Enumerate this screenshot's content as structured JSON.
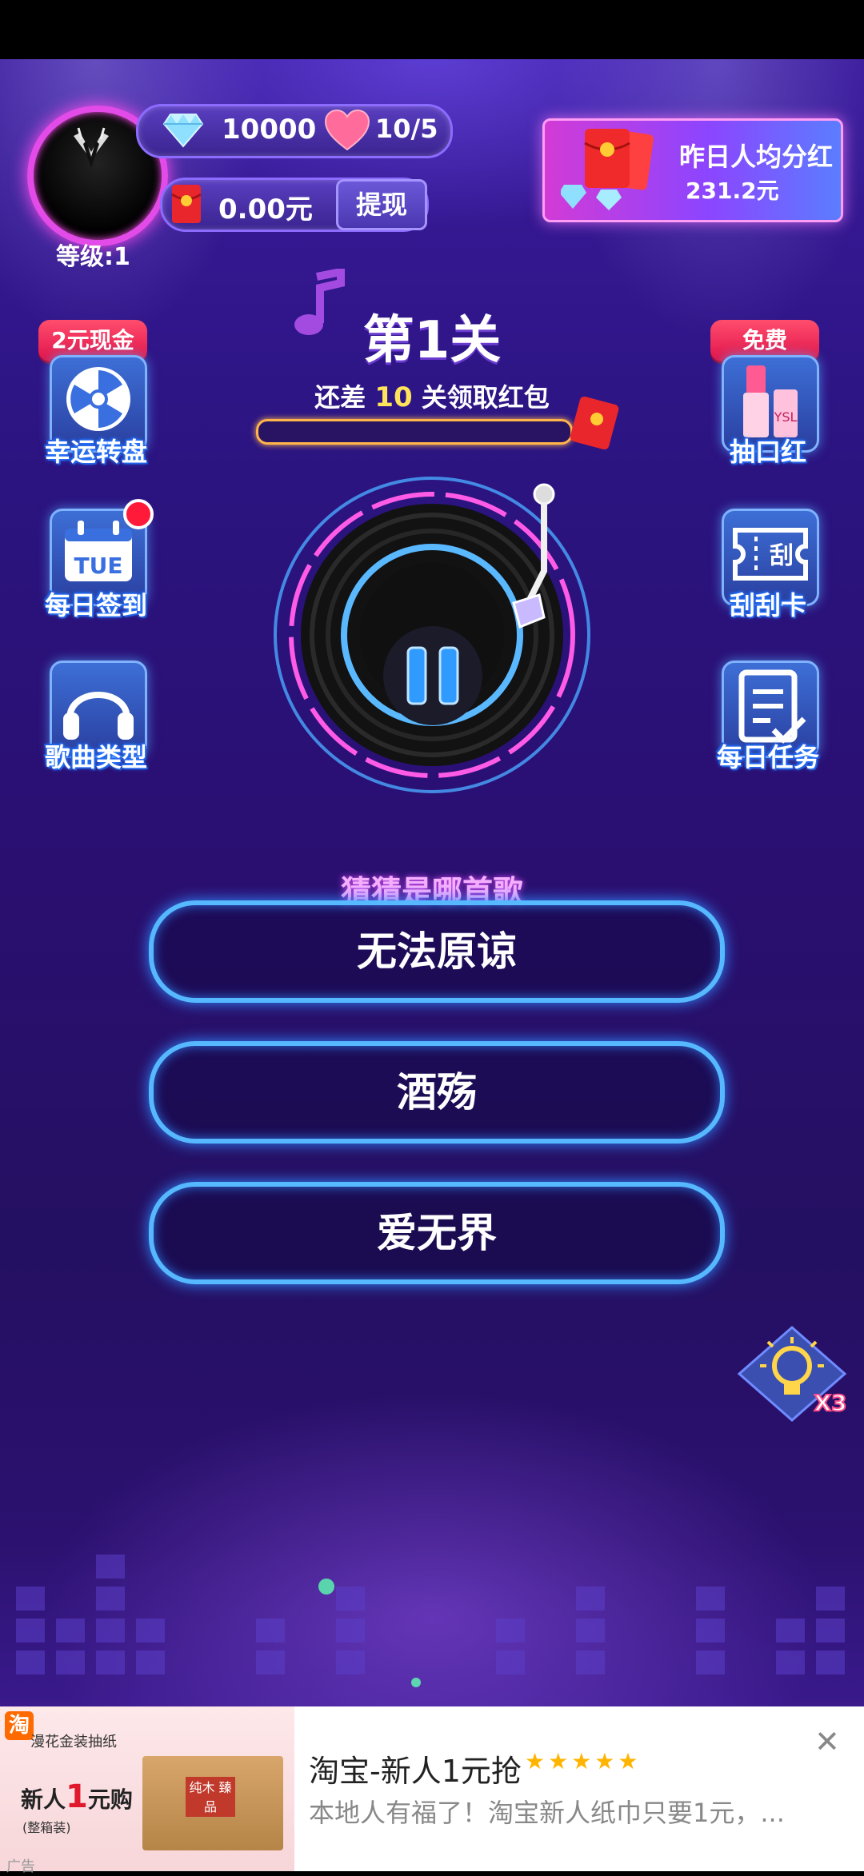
{
  "header": {
    "diamonds": "10000",
    "hearts": "10/5",
    "money": "0.00元",
    "withdraw_label": "提现",
    "level": "等级:1"
  },
  "bonus": {
    "title": "昨日人均分红",
    "value": "231.2元"
  },
  "left_buttons": [
    {
      "label": "幸运转盘",
      "ribbon": "2元现金",
      "icon": "wheel-icon"
    },
    {
      "label": "每日签到",
      "icon": "calendar-icon",
      "calendar_text": "TUE"
    },
    {
      "label": "歌曲类型",
      "icon": "headphones-icon"
    }
  ],
  "right_buttons": [
    {
      "label": "抽口红",
      "ribbon": "免费",
      "icon": "lipstick-icon"
    },
    {
      "label": "刮刮卡",
      "icon": "ticket-icon",
      "ticket_text": "刮"
    },
    {
      "label": "每日任务",
      "icon": "task-icon"
    }
  ],
  "game": {
    "level_title": "第1关",
    "hint_prefix": "还差",
    "hint_num": "10",
    "hint_suffix": "关领取红包",
    "progress": 0.0,
    "question": "猜猜是哪首歌",
    "answers": [
      "无法原谅",
      "酒殇",
      "爱无界"
    ],
    "hint_multiplier": "X3"
  },
  "ad": {
    "title": "淘宝-新人1元抢",
    "stars": "★★★★★",
    "description": "本地人有福了！淘宝新人纸巾只要1元，...",
    "close": "✕",
    "label": "广告",
    "image_logo": "淘",
    "image_title": "漫花金装抽纸",
    "image_big_prefix": "新人",
    "image_big_num": "1",
    "image_big_suffix": "元购",
    "image_sub": "(整箱装)",
    "box_label": "纯木 臻品"
  },
  "colors": {
    "neon_blue": "#56b8ff",
    "neon_pink": "#ff4df0",
    "ribbon_red": "#e0134a"
  }
}
